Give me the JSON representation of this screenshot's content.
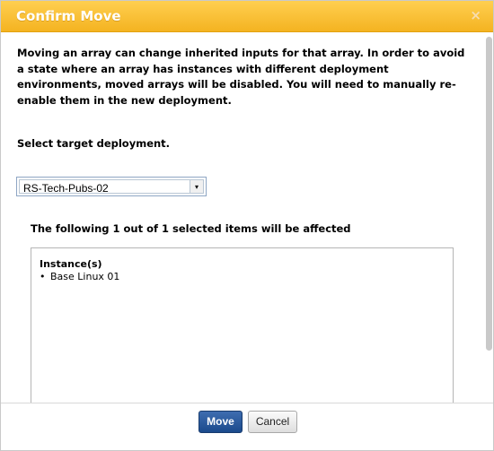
{
  "dialog": {
    "title": "Confirm Move",
    "close_glyph": "×",
    "message": "Moving an array can change inherited inputs for that array. In order to avoid a state where an array has instances with different deployment environments, moved arrays will be disabled. You will need to manually re-enable them in the new deployment.",
    "select_label": "Select target deployment.",
    "select": {
      "value": "RS-Tech-Pubs-02",
      "arrow_glyph": "▾"
    },
    "affected_header": "The following 1 out of 1 selected items will be affected",
    "affected_group": {
      "title": "Instance(s)",
      "items": [
        "Base Linux 01"
      ]
    },
    "buttons": {
      "move": "Move",
      "cancel": "Cancel"
    },
    "colors": {
      "titlebar": "#f4b321",
      "primary_button": "#1b4a8c"
    }
  }
}
